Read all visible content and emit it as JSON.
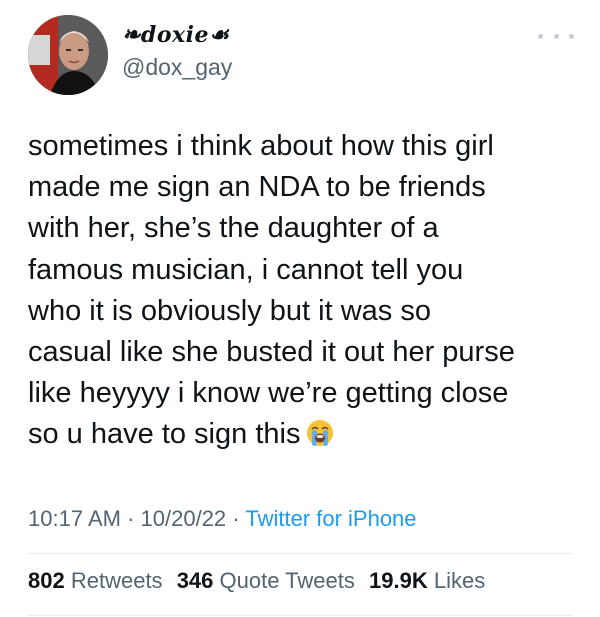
{
  "user": {
    "display_name": "❧doxie☙",
    "handle": "@dox_gay"
  },
  "tweet": {
    "text": "sometimes i think about how this girl\nmade me sign an NDA to be friends\nwith her, she’s the daughter of a\nfamous musician, i cannot tell you\nwho it is obviously but it was so\ncasual like she busted it out her purse\nlike heyyyy i know we’re getting close\nso u have to sign this",
    "emoji": "loudly-crying-face"
  },
  "meta": {
    "time": "10:17 AM",
    "separator": "·",
    "date": "10/20/22",
    "source": "Twitter for iPhone"
  },
  "stats": {
    "retweets": {
      "count": "802",
      "label": "Retweets"
    },
    "quotes": {
      "count": "346",
      "label": "Quote Tweets"
    },
    "likes": {
      "count": "19.9K",
      "label": "Likes"
    }
  },
  "colors": {
    "text_primary": "#0f1419",
    "text_secondary": "#536471",
    "link": "#1d9bf0",
    "divider": "#e6ecf0"
  },
  "icons": {
    "more": "more-horizontal-icon",
    "avatar": "avatar"
  }
}
